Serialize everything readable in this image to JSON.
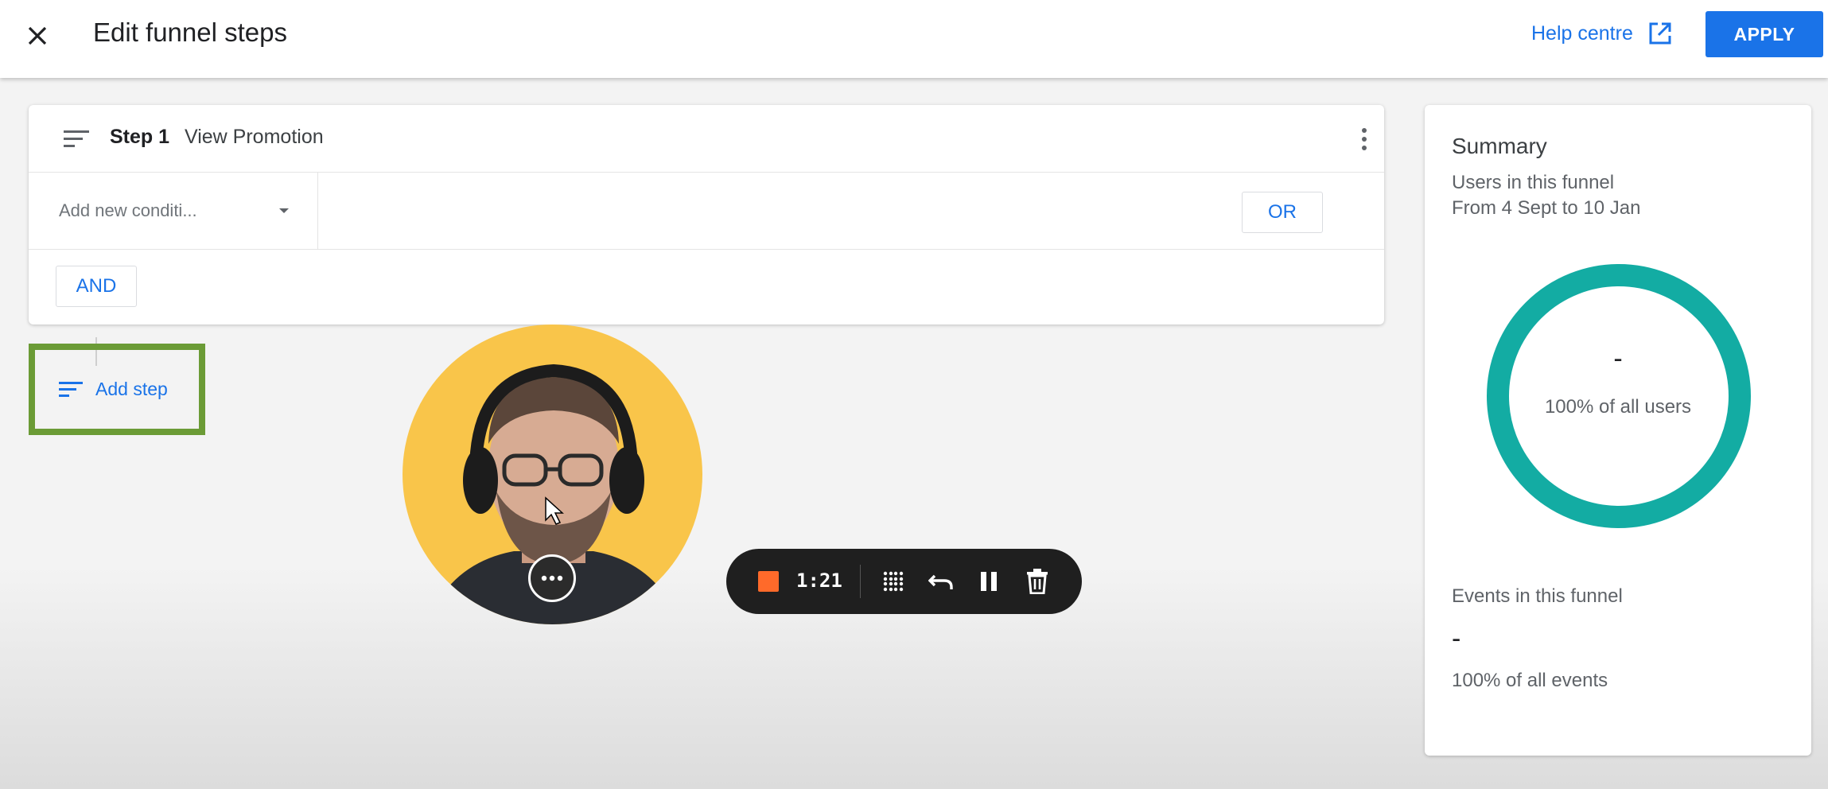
{
  "header": {
    "close_icon": "close-icon",
    "title": "Edit funnel steps",
    "help_label": "Help centre",
    "help_icon": "open-in-new-icon",
    "apply_label": "APPLY"
  },
  "step": {
    "handle_icon": "sort-lines-icon",
    "number_label": "Step 1",
    "name": "View Promotion",
    "menu_icon": "more-vert-icon",
    "condition_placeholder": "Add new conditi...",
    "or_label": "OR",
    "and_label": "AND"
  },
  "add_step": {
    "icon": "sort-lines-icon",
    "label": "Add step"
  },
  "recorder": {
    "time": "1:21",
    "stop_icon": "stop-icon",
    "grid_icon": "grid-dots-icon",
    "undo_icon": "undo-icon",
    "pause_icon": "pause-icon",
    "delete_icon": "trash-icon"
  },
  "webcam": {
    "more_icon": "more-horiz-icon"
  },
  "summary": {
    "title": "Summary",
    "users_label": "Users in this funnel",
    "date_range": "From 4 Sept to 10 Jan",
    "users_value": "-",
    "users_pct": "100% of all users",
    "events_label": "Events in this funnel",
    "events_value": "-",
    "events_pct": "100% of all events"
  },
  "colors": {
    "accent": "#1a73e8",
    "highlight_border": "#6b9b36",
    "donut": "#13aca3",
    "webcam_bg": "#f9c54a",
    "recorder_stop": "#ff6a2a"
  }
}
